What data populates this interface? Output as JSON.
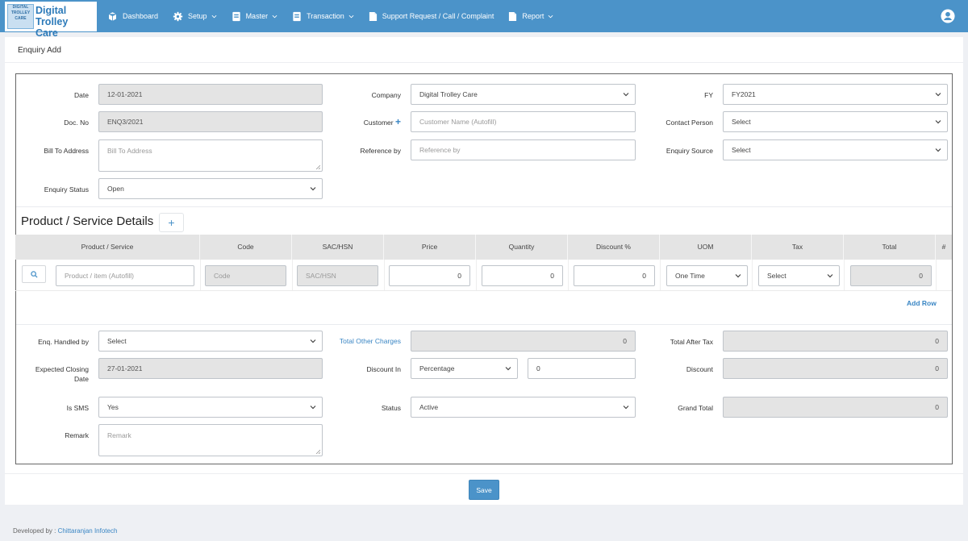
{
  "app": {
    "brand_line1": "Digital Trolley",
    "brand_line2": "Care",
    "qr_text": [
      "DIGITAL",
      "TROLLEY",
      "CARE"
    ]
  },
  "nav": {
    "items": [
      {
        "label": "Dashboard",
        "icon": "cube-icon",
        "dropdown": false
      },
      {
        "label": "Setup",
        "icon": "gear-icon",
        "dropdown": true
      },
      {
        "label": "Master",
        "icon": "book-icon",
        "dropdown": true
      },
      {
        "label": "Transaction",
        "icon": "book-icon",
        "dropdown": true
      },
      {
        "label": "Support Request / Call / Complaint",
        "icon": "file-icon",
        "dropdown": false
      },
      {
        "label": "Report",
        "icon": "file-icon",
        "dropdown": true
      }
    ]
  },
  "page": {
    "title": "Enquiry Add"
  },
  "form": {
    "date_label": "Date",
    "date_value": "12-01-2021",
    "doc_no_label": "Doc. No",
    "doc_no_value": "ENQ3/2021",
    "bill_to_label": "Bill To Address",
    "bill_to_placeholder": "Bill To Address",
    "enquiry_status_label": "Enquiry Status",
    "enquiry_status_value": "Open",
    "company_label": "Company",
    "company_value": "Digital Trolley Care",
    "customer_label": "Customer",
    "customer_placeholder": "Customer Name (Autofill)",
    "reference_label": "Reference by",
    "reference_placeholder": "Reference by",
    "fy_label": "FY",
    "fy_value": "FY2021",
    "contact_label": "Contact Person",
    "contact_value": "Select",
    "source_label": "Enquiry Source",
    "source_value": "Select"
  },
  "products": {
    "section_title": "Product / Service Details",
    "columns": [
      "Product / Service",
      "Code",
      "SAC/HSN",
      "Price",
      "Quantity",
      "Discount %",
      "UOM",
      "Tax",
      "Total",
      "#"
    ],
    "row": {
      "product_placeholder": "Product / item (Autofill)",
      "code_placeholder": "Code",
      "sac_placeholder": "SAC/HSN",
      "price": "0",
      "quantity": "0",
      "discount": "0",
      "uom": "One Time",
      "tax": "Select",
      "total": "0"
    },
    "add_row_label": "Add Row"
  },
  "footer_form": {
    "handled_by_label": "Enq. Handled by",
    "handled_by_value": "Select",
    "closing_date_label_1": "Expected Closing",
    "closing_date_label_2": "Date",
    "closing_date_value": "27-01-2021",
    "is_sms_label": "Is SMS",
    "is_sms_value": "Yes",
    "remark_label": "Remark",
    "remark_placeholder": "Remark",
    "other_charges_label": "Total Other Charges",
    "other_charges_value": "0",
    "discount_in_label": "Discount In",
    "discount_in_value": "Percentage",
    "discount_in_amount": "0",
    "status_label": "Status",
    "status_value": "Active",
    "total_after_tax_label": "Total After Tax",
    "total_after_tax_value": "0",
    "discount_label": "Discount",
    "discount_value": "0",
    "grand_total_label": "Grand Total",
    "grand_total_value": "0"
  },
  "actions": {
    "save_label": "Save"
  },
  "footer": {
    "developed_by": "Developed by : ",
    "developer": "Chittaranjan Infotech"
  }
}
